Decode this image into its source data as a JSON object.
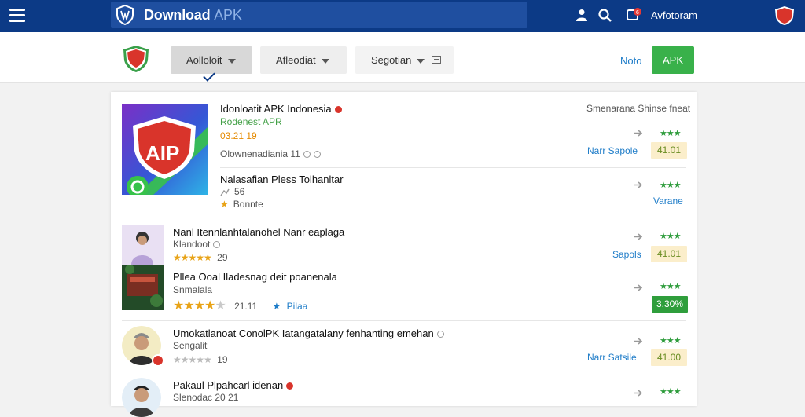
{
  "topbar": {
    "brand": "Download",
    "brand_suffix": "APK",
    "user_name": "Avfotoram",
    "app_badge": "APK"
  },
  "subheader": {
    "logo": "APK",
    "filters": [
      {
        "label": "Aolloloit"
      },
      {
        "label": "Afleodiat"
      },
      {
        "label": "Segotian"
      }
    ],
    "note_link": "Noto",
    "apk_button": "APK"
  },
  "list": {
    "right_header": "Smenarana Shinse fneat",
    "items": [
      {
        "title": "Idonloatit APK Indonesia",
        "subtitle": "Rodenest APR",
        "rating_text": "03.21 19",
        "meta": "Olownenadiania 11",
        "logo_text": "AIP",
        "action": "Narr Sapole",
        "badge": "41.01"
      },
      {
        "title": "Nalasafian Pless Tolhanltar",
        "meta1": "56",
        "meta2": "Bonnte",
        "action": "Varane"
      },
      {
        "title": "Nanl Itennlanhtalanohel Nanr eaplaga",
        "subtitle": "Klandoot",
        "rating_count": "29",
        "action": "Sapols",
        "badge": "41.01"
      },
      {
        "title": "Pllea Ooal Iladesnag deit poanenala",
        "subtitle": "Snmalala",
        "rating_value": "21.11",
        "tag": "Pilaa",
        "badge": "3.30%"
      },
      {
        "title": "Umokatlanoat ConolPK Iatangatalany fenhanting emehan",
        "subtitle": "Sengalit",
        "rating_count": "19",
        "action": "Narr Satsile",
        "badge": "41.00"
      },
      {
        "title": "Pakaul Plpahcarl idenan",
        "subtitle": "Slenodac 20 21"
      }
    ]
  },
  "colors": {
    "topbar": "#0c3a86",
    "accent_green": "#39b14a",
    "link_blue": "#1e7cc8"
  }
}
